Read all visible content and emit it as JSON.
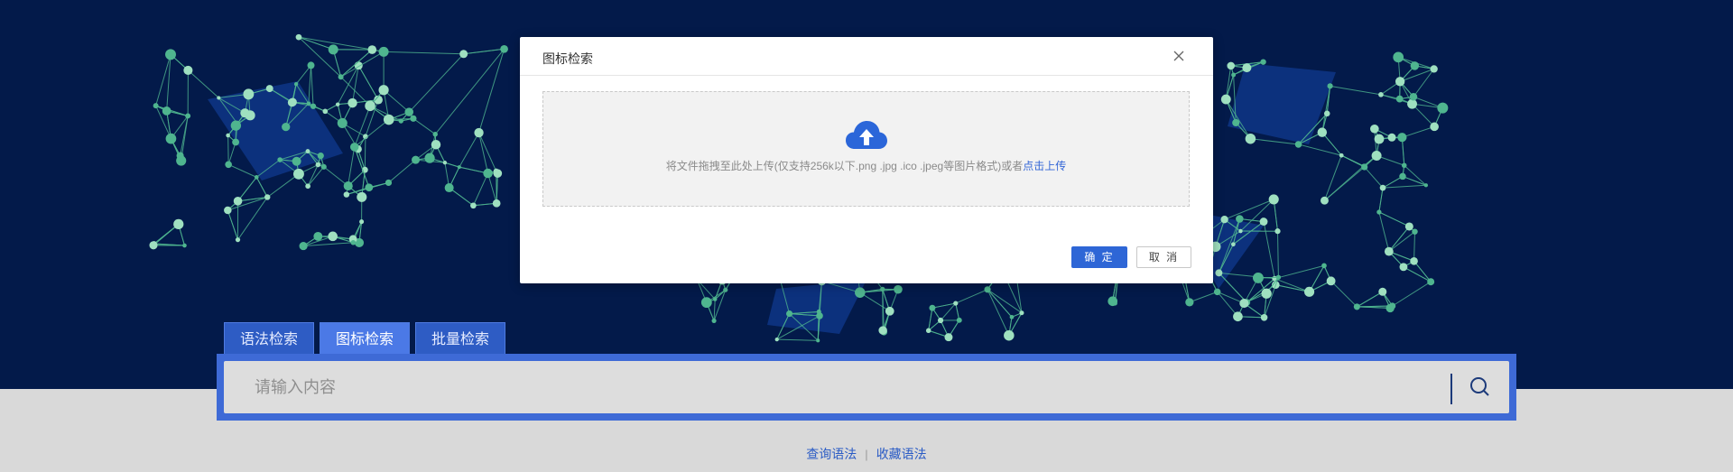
{
  "search": {
    "tabs": [
      {
        "label": "语法检索",
        "active": false
      },
      {
        "label": "图标检索",
        "active": true
      },
      {
        "label": "批量检索",
        "active": false
      }
    ],
    "placeholder": "请输入内容"
  },
  "links": {
    "query_syntax": "查询语法",
    "separator": "|",
    "saved_syntax": "收藏语法"
  },
  "modal": {
    "title": "图标检索",
    "drop_text": "将文件拖拽至此处上传(仅支持256k以下.png .jpg .ico .jpeg等图片格式)或者",
    "drop_link": "点击上传",
    "ok_label": "确 定",
    "cancel_label": "取 消"
  },
  "icons": {
    "search": "search-icon",
    "close": "close-icon",
    "upload": "cloud-upload-icon"
  },
  "colors": {
    "hero_bg": "#031a4a",
    "accent": "#2e66d6",
    "network_line": "#4fb58f",
    "network_node": "#9fe0c0"
  }
}
